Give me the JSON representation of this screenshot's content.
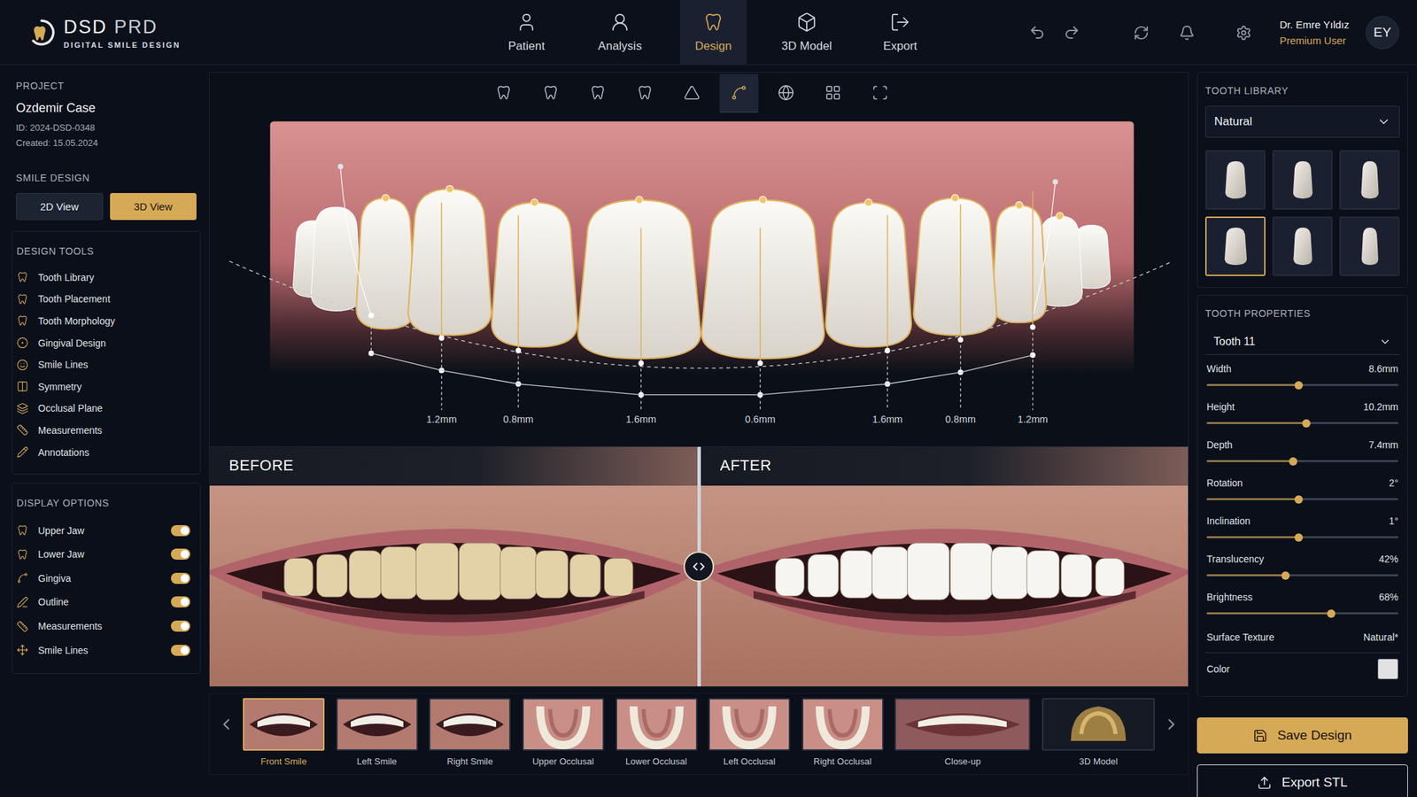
{
  "app": {
    "logo": {
      "name": "DSD",
      "suffix": "PRD",
      "tagline": "DIGITAL SMILE DESIGN"
    }
  },
  "nav": [
    {
      "label": "Patient",
      "selected": false
    },
    {
      "label": "Analysis",
      "selected": false
    },
    {
      "label": "Design",
      "selected": true
    },
    {
      "label": "3D Model",
      "selected": false
    },
    {
      "label": "Export",
      "selected": false
    }
  ],
  "user": {
    "name": "Dr. Emre Yıldız",
    "role": "Premium User",
    "initials": "EY"
  },
  "project": {
    "heading": "PROJECT",
    "name": "Ozdemir Case",
    "id": "ID: 2024-DSD-0348",
    "created": "Created: 15.05.2024"
  },
  "smile_design": {
    "heading": "SMILE DESIGN",
    "views": [
      {
        "label": "2D View",
        "selected": false
      },
      {
        "label": "3D View",
        "selected": true
      }
    ]
  },
  "design_tools": {
    "heading": "DESIGN TOOLS",
    "items": [
      "Tooth Library",
      "Tooth Placement",
      "Tooth Morphology",
      "Gingival Design",
      "Smile Lines",
      "Symmetry",
      "Occlusal Plane",
      "Measurements",
      "Annotations"
    ]
  },
  "display_options": {
    "heading": "DISPLAY OPTIONS",
    "items": [
      {
        "label": "Upper Jaw",
        "on": true
      },
      {
        "label": "Lower Jaw",
        "on": true
      },
      {
        "label": "Gingiva",
        "on": true
      },
      {
        "label": "Outline",
        "on": true
      },
      {
        "label": "Measurements",
        "on": true
      },
      {
        "label": "Smile Lines",
        "on": true
      }
    ]
  },
  "canvas_toolbar": [
    {
      "selected": false
    },
    {
      "selected": false
    },
    {
      "selected": false
    },
    {
      "selected": false
    },
    {
      "selected": false
    },
    {
      "selected": true
    },
    {
      "selected": false
    },
    {
      "selected": false
    },
    {
      "selected": false
    }
  ],
  "canvas": {
    "measurements": [
      "1.2mm",
      "0.8mm",
      "1.6mm",
      "0.6mm",
      "1.6mm",
      "0.8mm",
      "1.2mm"
    ]
  },
  "comparison": {
    "before": "BEFORE",
    "after": "AFTER"
  },
  "thumbnails": [
    {
      "label": "Front Smile",
      "kind": "smile",
      "selected": true
    },
    {
      "label": "Left Smile",
      "kind": "smile",
      "selected": false
    },
    {
      "label": "Right Smile",
      "kind": "smile",
      "selected": false
    },
    {
      "label": "Upper Occlusal",
      "kind": "occlusal",
      "selected": false
    },
    {
      "label": "Lower Occlusal",
      "kind": "occlusal",
      "selected": false
    },
    {
      "label": "Left Occlusal",
      "kind": "occlusal",
      "selected": false
    },
    {
      "label": "Right Occlusal",
      "kind": "occlusal",
      "selected": false
    },
    {
      "label": "Close-up",
      "kind": "closeup",
      "selected": false
    },
    {
      "label": "3D Model",
      "kind": "model",
      "selected": false
    }
  ],
  "tooth_library": {
    "heading": "TOOTH LIBRARY",
    "style": "Natural",
    "shapes": [
      {
        "selected": false
      },
      {
        "selected": false
      },
      {
        "selected": false
      },
      {
        "selected": true
      },
      {
        "selected": false
      },
      {
        "selected": false
      }
    ]
  },
  "tooth_properties": {
    "heading": "TOOTH PROPERTIES",
    "tooth": "Tooth 11",
    "sliders": [
      {
        "label": "Width",
        "value": "8.6mm",
        "level": 0.48
      },
      {
        "label": "Height",
        "value": "10.2mm",
        "level": 0.52
      },
      {
        "label": "Depth",
        "value": "7.4mm",
        "level": 0.45
      },
      {
        "label": "Rotation",
        "value": "2°",
        "level": 0.48
      },
      {
        "label": "Inclination",
        "value": "1°",
        "level": 0.48
      },
      {
        "label": "Translucency",
        "value": "42%",
        "level": 0.41
      },
      {
        "label": "Brightness",
        "value": "68%",
        "level": 0.65
      }
    ],
    "texture": {
      "label": "Surface Texture",
      "value": "Natural*"
    },
    "color": {
      "label": "Color",
      "swatch": "#e2e2e2"
    }
  },
  "actions": [
    {
      "label": "Save Design",
      "kind": "primary"
    },
    {
      "label": "Export STL",
      "kind": "secondary"
    }
  ]
}
